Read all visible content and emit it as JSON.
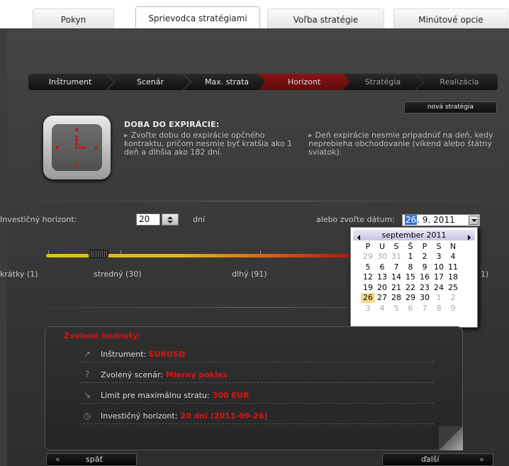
{
  "tabs": [
    {
      "label": "Pokyn"
    },
    {
      "label": "Sprievodca stratégiami"
    },
    {
      "label": "Voľba stratégie"
    },
    {
      "label": "Minútové opcie"
    }
  ],
  "steps": [
    {
      "label": "Inštrument"
    },
    {
      "label": "Scenár"
    },
    {
      "label": "Max. strata"
    },
    {
      "label": "Horizont"
    },
    {
      "label": "Stratégia"
    },
    {
      "label": "Realizácia"
    }
  ],
  "new_strategy_label": "nová stratégia",
  "info": {
    "title": "DOBA DO EXPIRÁCIE:",
    "bullet1": "Zvoľte dobu do expirácie opčného kontraktu, pričom nesmie byť kratšia ako 1 deň a dlhšia ako 182 dní.",
    "bullet2": "Deň expirácie nesmie pripadnúť na deň, kedy neprebieha obchodovanie (víkend alebo štátny sviatok)."
  },
  "horizon": {
    "label": "Investičný horizont:",
    "value": "20",
    "unit": "dní",
    "date_label": "alebo zvoľte dátum:",
    "date_selected": "26",
    "date_rest": ". 9. 2011",
    "slider_value": 20
  },
  "slider_labels": [
    {
      "label": "krátky (1)"
    },
    {
      "label": "stredný (30)"
    },
    {
      "label": "dlhý (91)"
    },
    {
      "label": "1)"
    }
  ],
  "calendar": {
    "month": "september 2011",
    "weekdays": [
      "P",
      "U",
      "S",
      "Š",
      "P",
      "S",
      "N"
    ],
    "weeks": [
      [
        "29",
        "30",
        "31",
        "1",
        "2",
        "3",
        "4"
      ],
      [
        "5",
        "6",
        "7",
        "8",
        "9",
        "10",
        "11"
      ],
      [
        "12",
        "13",
        "14",
        "15",
        "16",
        "17",
        "18"
      ],
      [
        "19",
        "20",
        "21",
        "22",
        "23",
        "24",
        "25"
      ],
      [
        "26",
        "27",
        "28",
        "29",
        "30",
        "1",
        "2"
      ],
      [
        "3",
        "4",
        "5",
        "6",
        "7",
        "8",
        "9"
      ]
    ]
  },
  "summary": {
    "title": "Zvolené hodnoty:",
    "rows": [
      {
        "key": "Inštrument:",
        "value": "EURUSD",
        "icon": "arrow-icon"
      },
      {
        "key": "Zvolený scenár:",
        "value": "Mierny pokles",
        "icon": "question-icon"
      },
      {
        "key": "Limit pre maximálnu stratu:",
        "value": "300 EUR",
        "icon": "chart-icon"
      },
      {
        "key": "Investičný horizont:",
        "value": "20 dní (2011-09-26)",
        "icon": "clock-icon"
      }
    ]
  },
  "nav": {
    "back_label": "späť",
    "back_glyph": "«",
    "next_label": "ďalší",
    "next_glyph": "»"
  },
  "colors": {
    "accent": "#c01818",
    "active_step": "#7a1111"
  }
}
